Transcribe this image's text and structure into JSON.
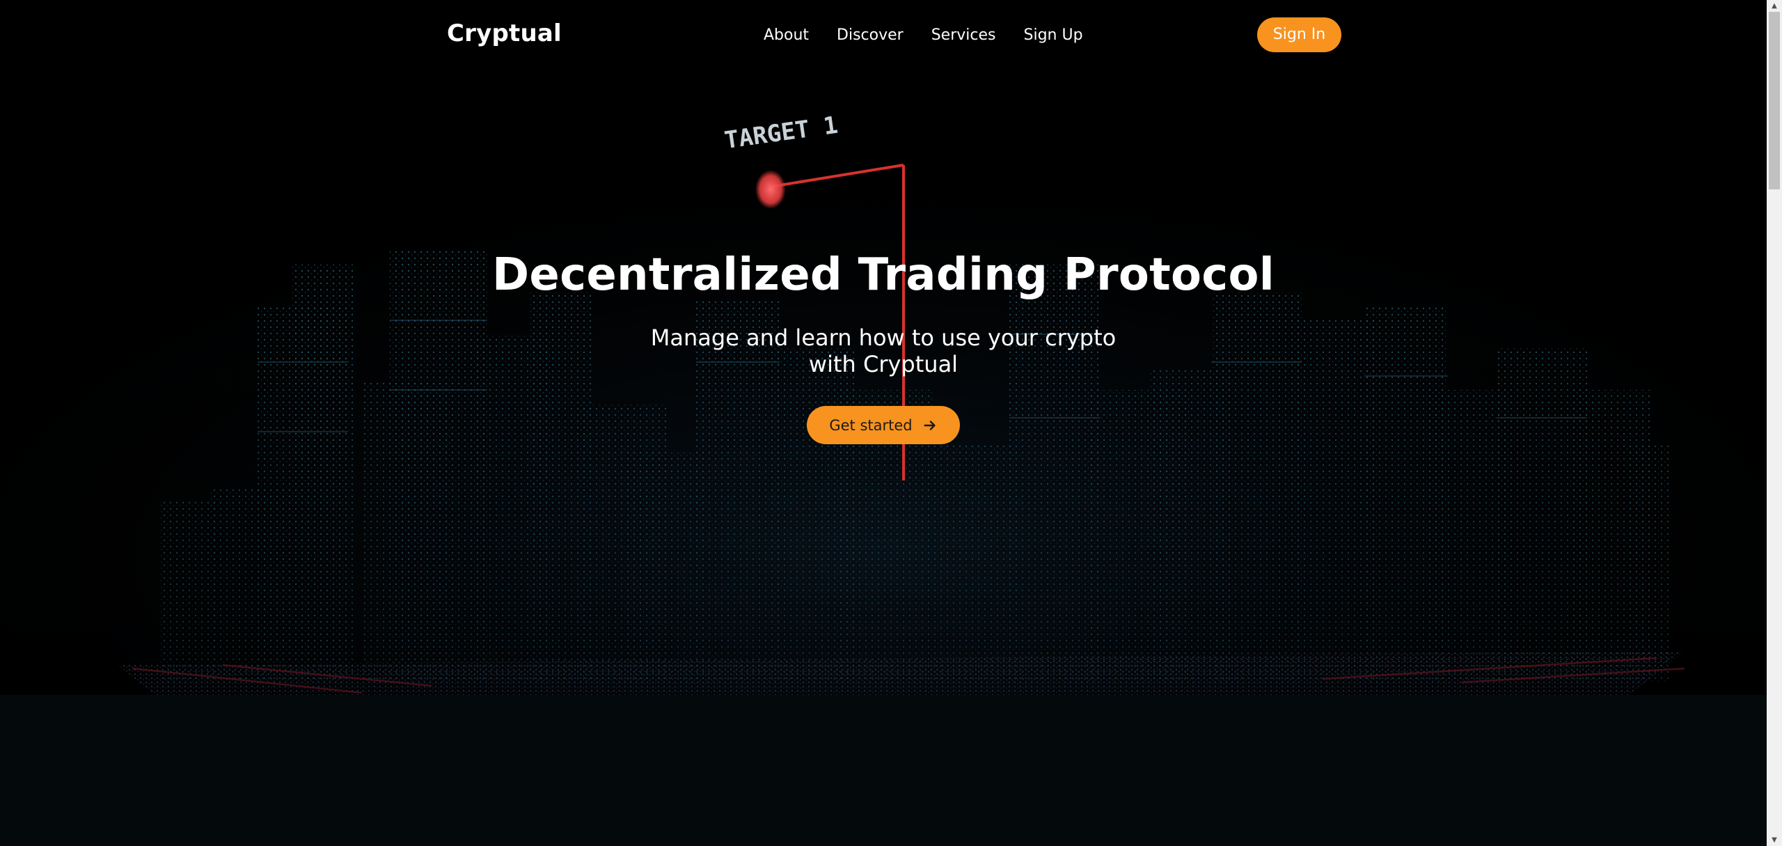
{
  "brand": {
    "name": "Cryptual"
  },
  "nav": {
    "links": [
      {
        "label": "About"
      },
      {
        "label": "Discover"
      },
      {
        "label": "Services"
      },
      {
        "label": "Sign Up"
      }
    ],
    "sign_in_label": "Sign In"
  },
  "hero": {
    "title": "Decentralized Trading Protocol",
    "subtitle": "Manage and learn how to use your crypto with Cryptual",
    "cta_label": "Get started",
    "cta_icon": "arrow-right-icon",
    "background_sign_text": "TARGET 1"
  },
  "colors": {
    "accent": "#f7931e",
    "background": "#000000",
    "below_hero_background": "#040a0b",
    "text": "#ffffff"
  }
}
